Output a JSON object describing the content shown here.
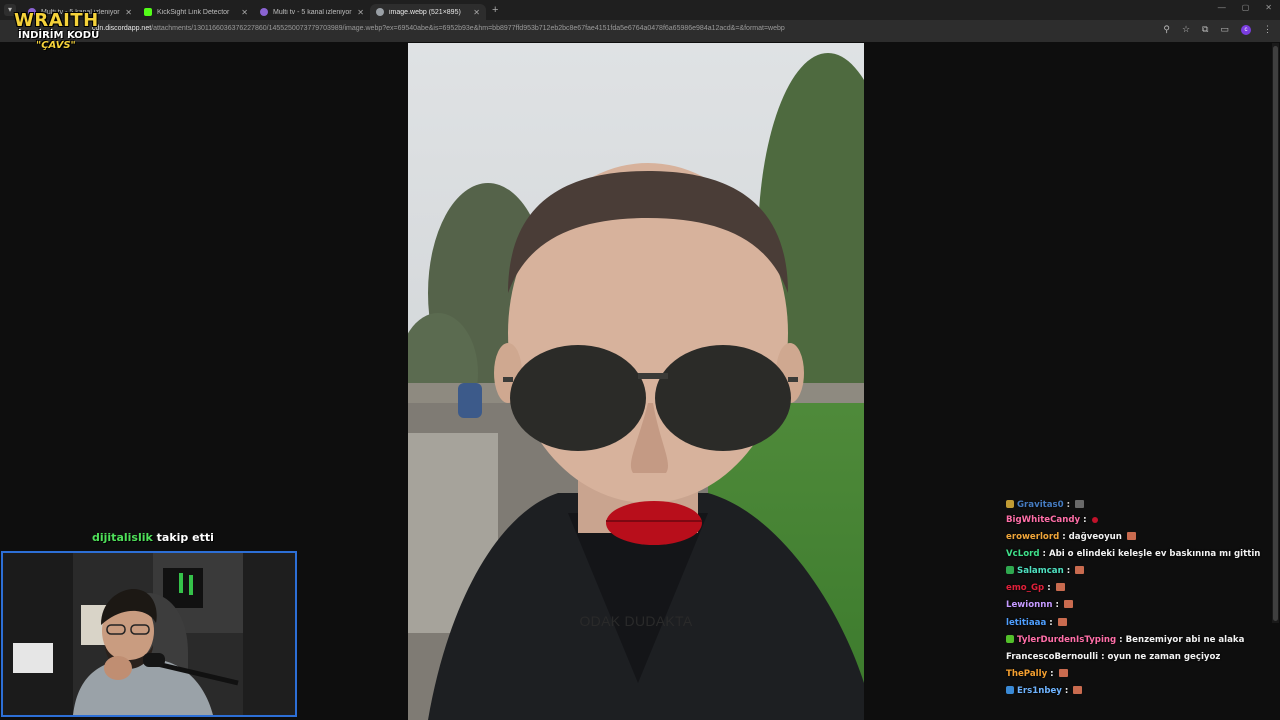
{
  "browser": {
    "tabs": [
      {
        "title": "Multi tv - 5 kanal izleniyor",
        "favicon_color": "#8a63d2",
        "active": false
      },
      {
        "title": "KickSight Link Detector",
        "favicon_color": "#53fc18",
        "active": false
      },
      {
        "title": "Multi tv - 5 kanal izleniyor",
        "favicon_color": "#8a63d2",
        "active": false
      },
      {
        "title": "image.webp (521×895)",
        "favicon_color": "#9aa0a6",
        "active": true
      }
    ],
    "new_tab": "+",
    "url_host": "cdn.discordapp.net",
    "url_path": "/attachments/1301166036376227860/1455250073779703989/image.webp?ex=69540abe&is=6952b93e&hm=bb8977ffd953b712eb2bc8e67fae4151fda5e6764a0478f6a65986e984a12acd&=&format=webp",
    "profile_initial": "c"
  },
  "overlay": {
    "brand": "WRAITH",
    "promo": "İNDİRİM KODU",
    "code": "\"ÇAVS\""
  },
  "image": {
    "caption": "ODAK DUDAKTA"
  },
  "follow_alert": {
    "name": "dijitalislik",
    "text": " takip etti"
  },
  "chat": {
    "messages": [
      {
        "user": "Gravitas0",
        "color": "#4f8fe0",
        "text": "",
        "badge": "#e0b43b",
        "emote": "gray",
        "partial": true
      },
      {
        "user": "BigWhiteCandy",
        "color": "#ff6fa8",
        "text": "",
        "emote": "red"
      },
      {
        "user": "erowerlord",
        "color": "#f0a63a",
        "text": "dağveoyun",
        "emote": "brick"
      },
      {
        "user": "VcLord",
        "color": "#3fe08a",
        "text": "Abi o elindeki keleşle ev baskınına mı gittin"
      },
      {
        "user": "Salamcan",
        "color": "#4fe0c0",
        "text": "",
        "badge": "#2fa84f",
        "emote": "brick"
      },
      {
        "user": "emo_Gp",
        "color": "#e0203a",
        "text": "",
        "emote": "brick"
      },
      {
        "user": "Lewionnn",
        "color": "#c59aff",
        "text": "",
        "emote": "brick"
      },
      {
        "user": "letitiaaa",
        "color": "#4f9fff",
        "text": "",
        "emote": "brick"
      },
      {
        "user": "TylerDurdenIsTyping",
        "color": "#ff6fa8",
        "text": "Benzemiyor abi ne alaka",
        "badge": "#53c02a"
      },
      {
        "user": "FrancescoBernoulli",
        "color": "#f2f2f2",
        "text": "oyun ne zaman geçiyoz"
      },
      {
        "user": "ThePally",
        "color": "#f5a030",
        "text": "",
        "emote": "brick"
      },
      {
        "user": "Ers1nbey",
        "color": "#6fb4ff",
        "text": "",
        "badge": "#3a8ad6",
        "emote": "brick"
      }
    ]
  }
}
